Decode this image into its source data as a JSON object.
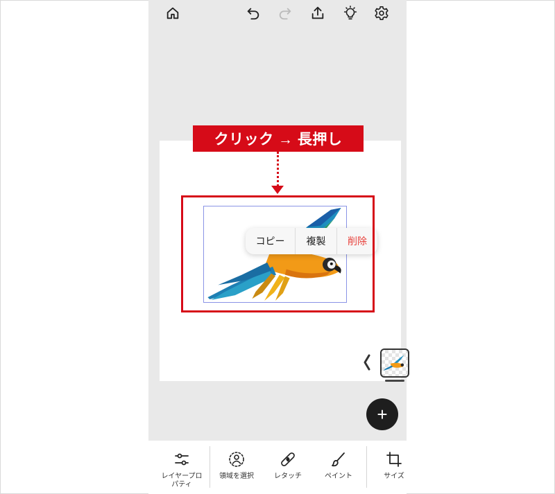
{
  "annotation": {
    "label": "クリック → 長押し",
    "color": "#d60b18"
  },
  "topbar": {
    "icons": [
      "home-icon",
      "undo-icon",
      "redo-icon",
      "share-icon",
      "lightbulb-icon",
      "gear-icon"
    ]
  },
  "context_menu": {
    "copy_label": "コピー",
    "duplicate_label": "複製",
    "delete_label": "削除",
    "delete_color": "#e8413b"
  },
  "fab": {
    "label": "+"
  },
  "toolbar": {
    "items": [
      {
        "label": "レイヤープロ\nパティ",
        "icon": "sliders-icon"
      },
      {
        "label": "領域を選択",
        "icon": "select-person-icon"
      },
      {
        "label": "レタッチ",
        "icon": "bandage-icon"
      },
      {
        "label": "ペイント",
        "icon": "brush-icon"
      },
      {
        "label": "サイズ",
        "icon": "crop-icon"
      }
    ]
  }
}
